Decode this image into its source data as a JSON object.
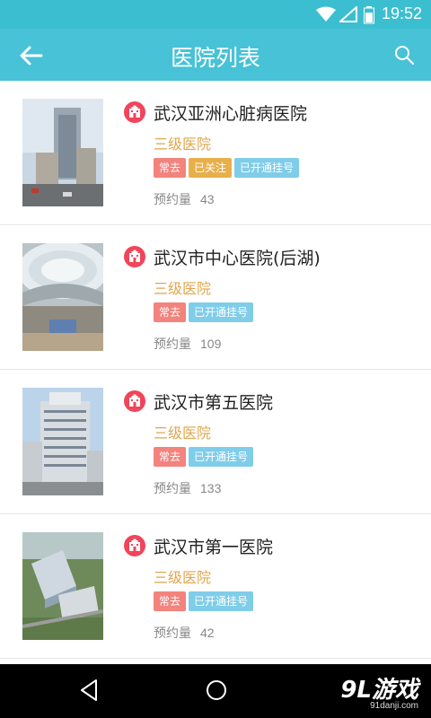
{
  "status_bar": {
    "time": "19:52"
  },
  "app_bar": {
    "title": "医院列表"
  },
  "hospitals": [
    {
      "name": "武汉亚洲心脏病医院",
      "level": "三级医院",
      "tags": [
        "常去",
        "已关注",
        "已开通挂号"
      ],
      "count_label": "预约量",
      "count": "43"
    },
    {
      "name": "武汉市中心医院(后湖)",
      "level": "三级医院",
      "tags": [
        "常去",
        "已开通挂号"
      ],
      "count_label": "预约量",
      "count": "109"
    },
    {
      "name": "武汉市第五医院",
      "level": "三级医院",
      "tags": [
        "常去",
        "已开通挂号"
      ],
      "count_label": "预约量",
      "count": "133"
    },
    {
      "name": "武汉市第一医院",
      "level": "三级医院",
      "tags": [
        "常去",
        "已开通挂号"
      ],
      "count_label": "预约量",
      "count": "42"
    }
  ],
  "watermark": {
    "brand": "9L游戏",
    "url": "91danji.com"
  },
  "colors": {
    "header": "#47c2d6",
    "level": "#e0a64d",
    "tag_often": "#f2837d",
    "tag_follow": "#e8b04b",
    "tag_open": "#7fcde9",
    "hospital_icon": "#f0455a"
  }
}
